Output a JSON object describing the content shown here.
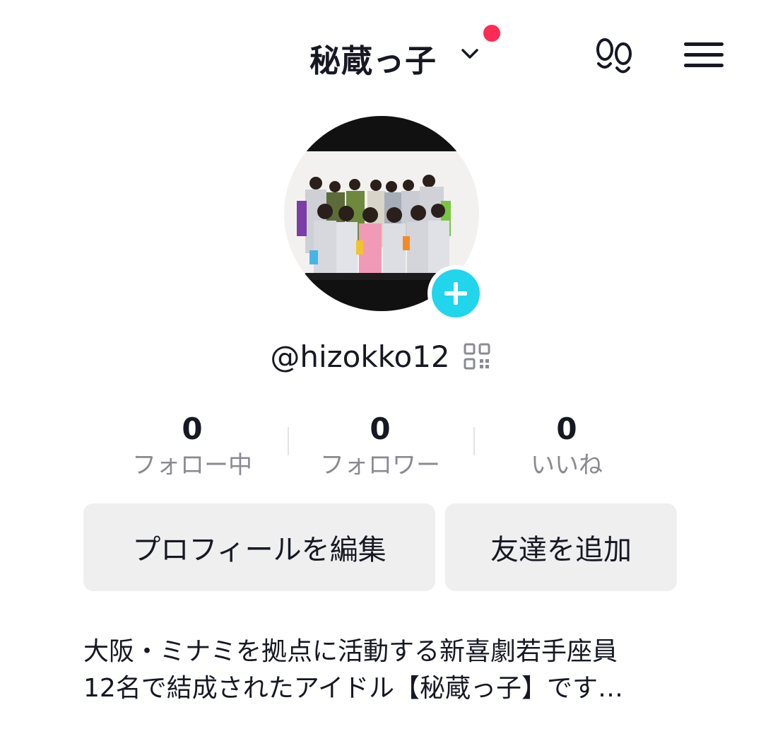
{
  "header": {
    "title": "秘蔵っ子",
    "has_notification_dot": true,
    "notification_color": "#fe2c55",
    "icons": [
      "chevron-down-icon",
      "footprint-icon",
      "menu-icon"
    ]
  },
  "profile": {
    "avatar_alt": "group photo",
    "add_icon": "plus-icon",
    "add_color": "#20d5ec",
    "username": "@hizokko12",
    "qr_icon": "qr-code-icon"
  },
  "stats": [
    {
      "value": "0",
      "label": "フォロー中"
    },
    {
      "value": "0",
      "label": "フォロワー"
    },
    {
      "value": "0",
      "label": "いいね"
    }
  ],
  "actions": {
    "edit_profile": "プロフィールを編集",
    "add_friends": "友達を追加"
  },
  "bio": {
    "line1": "大阪・ミナミを拠点に活動する新喜劇若手座員",
    "line2": "12名で結成されたアイドル【秘蔵っ子】です…"
  }
}
